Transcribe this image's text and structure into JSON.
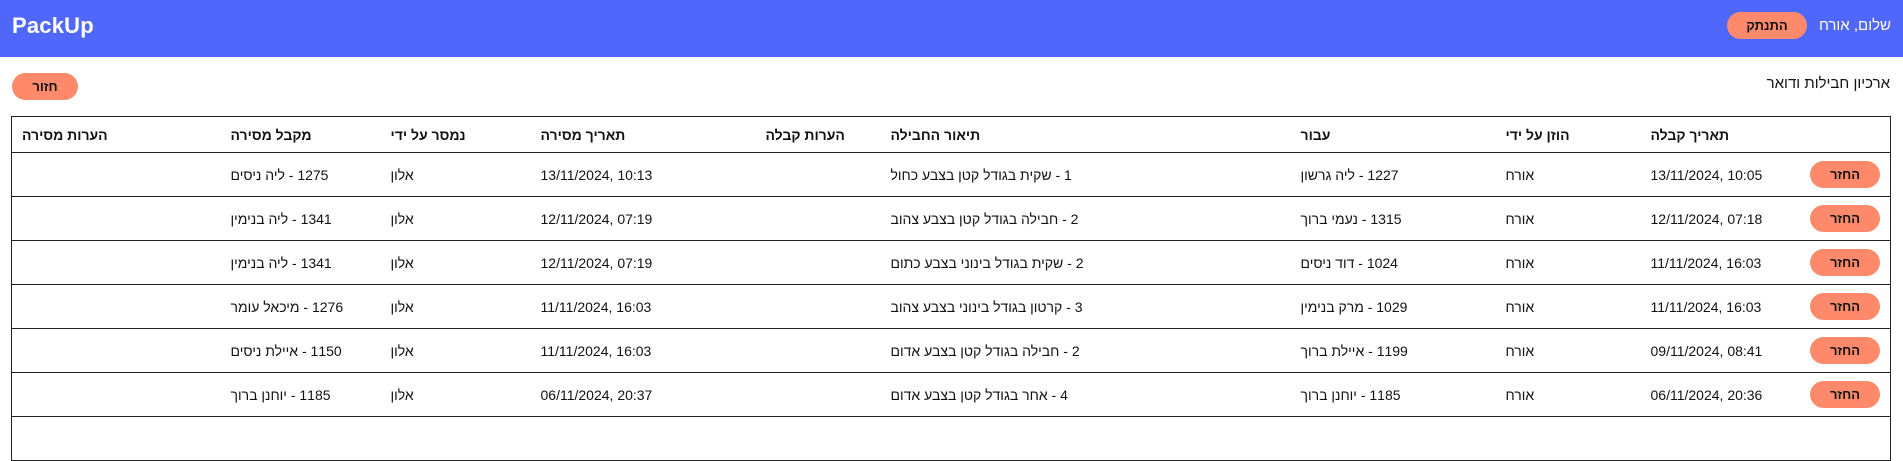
{
  "header": {
    "brand": "PackUp",
    "greeting": "שלום, אורח",
    "logout_label": "התנתק"
  },
  "page": {
    "title": "ארכיון חבילות ודואר",
    "back_label": "חזור"
  },
  "table": {
    "columns": [
      "",
      "תאריך קבלה",
      "הוזן על ידי",
      "עבור",
      "תיאור החבילה",
      "הערות קבלה",
      "תאריך מסירה",
      "נמסר על ידי",
      "מקבל מסירה",
      "הערות מסירה"
    ],
    "row_action_label": "החזר",
    "rows": [
      {
        "received": "10:05 ,13/11/2024",
        "entered_by": "אורח",
        "for": "1227 - ליה גרשון",
        "description": "1 - שקית בגודל קטן בצבע כחול",
        "receive_notes": "",
        "delivered": "10:13 ,13/11/2024",
        "delivered_by": "אלון",
        "recipient": "1275 - ליה ניסים",
        "delivery_notes": ""
      },
      {
        "received": "07:18 ,12/11/2024",
        "entered_by": "אורח",
        "for": "1315 - נעמי ברוך",
        "description": "2 - חבילה בגודל קטן בצבע צהוב",
        "receive_notes": "",
        "delivered": "07:19 ,12/11/2024",
        "delivered_by": "אלון",
        "recipient": "1341 - ליה בנימין",
        "delivery_notes": ""
      },
      {
        "received": "16:03 ,11/11/2024",
        "entered_by": "אורח",
        "for": "1024 - דוד ניסים",
        "description": "2 - שקית בגודל בינוני בצבע כתום",
        "receive_notes": "",
        "delivered": "07:19 ,12/11/2024",
        "delivered_by": "אלון",
        "recipient": "1341 - ליה בנימין",
        "delivery_notes": ""
      },
      {
        "received": "16:03 ,11/11/2024",
        "entered_by": "אורח",
        "for": "1029 - מרק בנימין",
        "description": "3 - קרטון בגודל בינוני בצבע צהוב",
        "receive_notes": "",
        "delivered": "16:03 ,11/11/2024",
        "delivered_by": "אלון",
        "recipient": "1276 - מיכאל עומר",
        "delivery_notes": ""
      },
      {
        "received": "08:41 ,09/11/2024",
        "entered_by": "אורח",
        "for": "1199 - איילת ברוך",
        "description": "2 - חבילה בגודל קטן בצבע אדום",
        "receive_notes": "",
        "delivered": "16:03 ,11/11/2024",
        "delivered_by": "אלון",
        "recipient": "1150 - איילת ניסים",
        "delivery_notes": ""
      },
      {
        "received": "20:36 ,06/11/2024",
        "entered_by": "אורח",
        "for": "1185 - יוחנן ברוך",
        "description": "4 - אחר בגודל קטן בצבע אדום",
        "receive_notes": "",
        "delivered": "20:37 ,06/11/2024",
        "delivered_by": "אלון",
        "recipient": "1185 - יוחנן ברוך",
        "delivery_notes": ""
      },
      {
        "received": "",
        "entered_by": "",
        "for": "",
        "description": "",
        "receive_notes": "",
        "delivered": "",
        "delivered_by": "",
        "recipient": "",
        "delivery_notes": ""
      }
    ]
  },
  "colors": {
    "header_bg": "#4f67fb",
    "button_bg": "#ff8a6b"
  }
}
